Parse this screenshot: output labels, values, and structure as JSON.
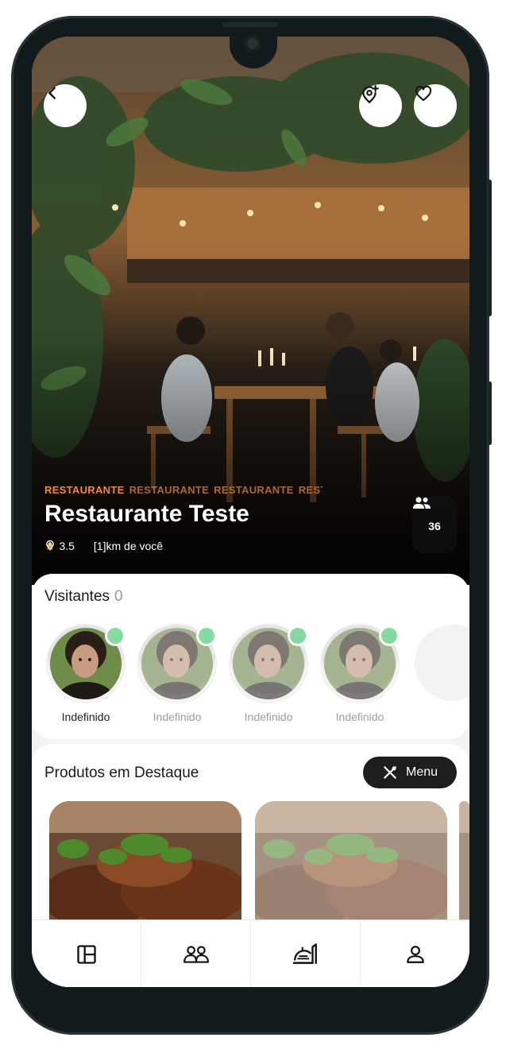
{
  "restaurant": {
    "tags": [
      "RESTAURANTE",
      "RESTAURANTE",
      "RESTAURANTE",
      "RESTA"
    ],
    "name": "Restaurante Teste",
    "rating": "3.5",
    "distance": "[1]km de você",
    "people_count": "36"
  },
  "header": {
    "back_icon": "chevron-left-icon",
    "add_location_icon": "map-pin-plus-icon",
    "favorite_icon": "heart-icon"
  },
  "visitors": {
    "title": "Visitantes",
    "count": "0",
    "items": [
      {
        "name": "Indefinido",
        "online": true
      },
      {
        "name": "Indefinido",
        "online": true
      },
      {
        "name": "Indefinido",
        "online": true
      },
      {
        "name": "Indefinido",
        "online": true
      }
    ]
  },
  "products": {
    "title": "Produtos em Destaque",
    "menu_label": "Menu"
  },
  "bottom_nav": [
    {
      "icon": "layout-icon"
    },
    {
      "icon": "users-icon"
    },
    {
      "icon": "food-tray-icon"
    },
    {
      "icon": "user-icon"
    }
  ],
  "colors": {
    "accent": "#f08a3a",
    "online": "#86d9a0",
    "dark": "#1e1e1e"
  }
}
